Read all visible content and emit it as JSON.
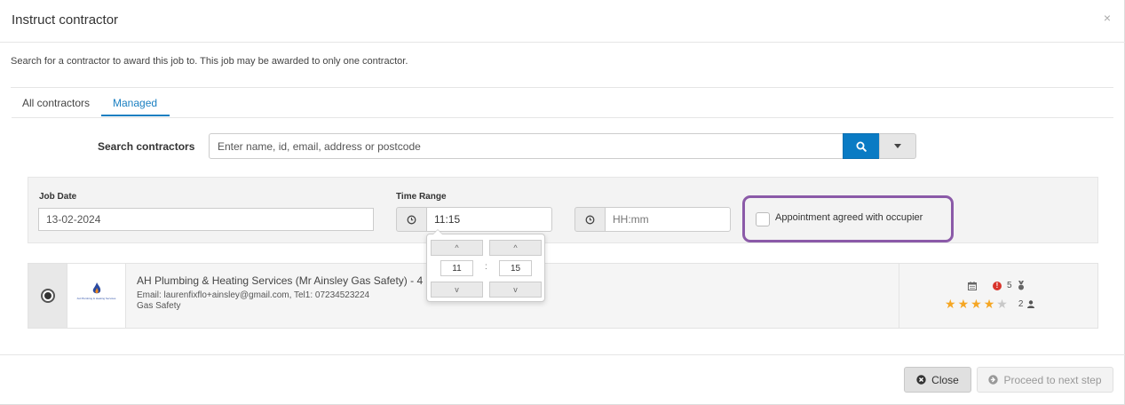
{
  "modal": {
    "title": "Instruct contractor",
    "close_symbol": "×",
    "description": "Search for a contractor to award this job to. This job may be awarded to only one contractor."
  },
  "tabs": [
    {
      "label": "All contractors",
      "active": false
    },
    {
      "label": "Managed",
      "active": true
    }
  ],
  "search": {
    "label": "Search contractors",
    "placeholder": "Enter name, id, email, address or postcode",
    "value": "",
    "button_icon": "search-icon",
    "dropdown_icon": "caret-down-icon"
  },
  "filters": {
    "job_date_label": "Job Date",
    "job_date_value": "13-02-2024",
    "time_range_label": "Time Range",
    "time_from_value": "11:15",
    "time_to_placeholder": "HH:mm",
    "appointment_label": "Appointment agreed with occupier",
    "appointment_checked": false
  },
  "timepicker": {
    "hours": "11",
    "separator": ":",
    "minutes": "15",
    "up_symbol": "^",
    "down_symbol": "v"
  },
  "contractor": {
    "selected": true,
    "logo_text": "AH Plumbing & Heating Services",
    "name": "AH Plumbing & Heating Services (Mr Ainsley Gas Safety) - 4 mi",
    "contact": "Email: laurenfixflo+ainsley@gmail.com, Tel1: 07234523224",
    "category": "Gas Safety",
    "alert_count": "5",
    "rating": 4,
    "rating_max": 5,
    "reviews_count": "2"
  },
  "footer": {
    "close_label": "Close",
    "next_label": "Proceed to next step"
  },
  "colors": {
    "accent": "#0a7bc4",
    "highlight_border": "#8b5aa8",
    "star": "#f5a623",
    "alert": "#d9342b"
  }
}
